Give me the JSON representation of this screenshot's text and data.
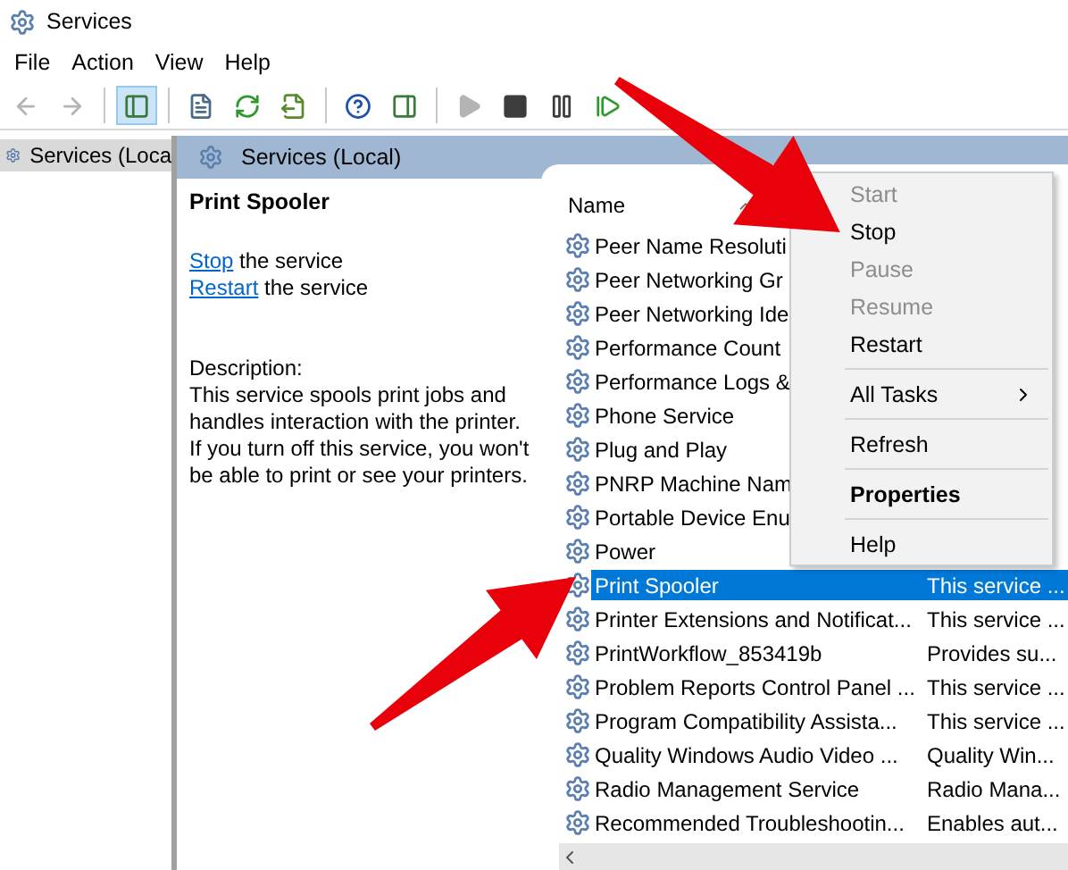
{
  "window": {
    "title": "Services"
  },
  "menu_bar": [
    "File",
    "Action",
    "View",
    "Help"
  ],
  "toolbar": [
    {
      "kind": "back",
      "disabled": true,
      "pressed": false
    },
    {
      "kind": "forward",
      "disabled": true,
      "pressed": false
    },
    {
      "kind": "separator"
    },
    {
      "kind": "console-tree",
      "disabled": false,
      "pressed": true
    },
    {
      "kind": "separator"
    },
    {
      "kind": "properties",
      "disabled": false,
      "pressed": false
    },
    {
      "kind": "refresh",
      "disabled": false,
      "pressed": false
    },
    {
      "kind": "export",
      "disabled": false,
      "pressed": false
    },
    {
      "kind": "separator"
    },
    {
      "kind": "help",
      "disabled": false,
      "pressed": false
    },
    {
      "kind": "action-pane",
      "disabled": false,
      "pressed": false
    },
    {
      "kind": "separator"
    },
    {
      "kind": "play",
      "disabled": true,
      "pressed": false
    },
    {
      "kind": "stop",
      "disabled": false,
      "pressed": false
    },
    {
      "kind": "pause",
      "disabled": false,
      "pressed": false
    },
    {
      "kind": "resume",
      "disabled": false,
      "pressed": false
    }
  ],
  "tree": {
    "items": [
      {
        "label": "Services (Loca",
        "selected": true
      }
    ]
  },
  "pane": {
    "title": "Services (Local)",
    "detail": {
      "title": "Print Spooler",
      "actions": [
        {
          "link": "Stop",
          "text": "the service"
        },
        {
          "link": "Restart",
          "text": "the service"
        }
      ],
      "description_label": "Description:",
      "description": "This service spools print jobs and handles interaction with the printer. If you turn off this service, you won't be able to print or see your printers."
    },
    "list": {
      "columns": [
        {
          "label": "Name",
          "sorted": true
        }
      ],
      "rows": [
        {
          "name": "Peer Name Resoluti",
          "selected": false
        },
        {
          "name": "Peer Networking Gr",
          "selected": false
        },
        {
          "name": "Peer Networking Ide",
          "selected": false
        },
        {
          "name": "Performance Count",
          "selected": false
        },
        {
          "name": "Performance Logs &",
          "selected": false
        },
        {
          "name": "Phone Service",
          "selected": false
        },
        {
          "name": "Plug and Play",
          "selected": false
        },
        {
          "name": "PNRP Machine Nam",
          "selected": false
        },
        {
          "name": "Portable Device Enu",
          "selected": false
        },
        {
          "name": "Power",
          "selected": false
        },
        {
          "name": "Print Spooler",
          "description": "This service ...",
          "selected": true
        },
        {
          "name": "Printer Extensions and Notificat...",
          "description": "This service ...",
          "selected": false
        },
        {
          "name": "PrintWorkflow_853419b",
          "description": "Provides su...",
          "selected": false
        },
        {
          "name": "Problem Reports Control Panel ...",
          "description": "This service ...",
          "selected": false
        },
        {
          "name": "Program Compatibility Assista...",
          "description": "This service ...",
          "selected": false
        },
        {
          "name": "Quality Windows Audio Video ...",
          "description": "Quality Win...",
          "selected": false
        },
        {
          "name": "Radio Management Service",
          "description": "Radio Mana...",
          "selected": false
        },
        {
          "name": "Recommended Troubleshootin...",
          "description": "Enables aut...",
          "selected": false
        }
      ]
    }
  },
  "context_menu": {
    "items": [
      {
        "kind": "item",
        "label": "Start",
        "disabled": true,
        "default": false,
        "submenu": false
      },
      {
        "kind": "item",
        "label": "Stop",
        "disabled": false,
        "default": false,
        "submenu": false
      },
      {
        "kind": "item",
        "label": "Pause",
        "disabled": true,
        "default": false,
        "submenu": false
      },
      {
        "kind": "item",
        "label": "Resume",
        "disabled": true,
        "default": false,
        "submenu": false
      },
      {
        "kind": "item",
        "label": "Restart",
        "disabled": false,
        "default": false,
        "submenu": false
      },
      {
        "kind": "separator"
      },
      {
        "kind": "item",
        "label": "All Tasks",
        "disabled": false,
        "default": false,
        "submenu": true
      },
      {
        "kind": "separator"
      },
      {
        "kind": "item",
        "label": "Refresh",
        "disabled": false,
        "default": false,
        "submenu": false
      },
      {
        "kind": "separator"
      },
      {
        "kind": "item",
        "label": "Properties",
        "disabled": false,
        "default": true,
        "submenu": false
      },
      {
        "kind": "separator"
      },
      {
        "kind": "item",
        "label": "Help",
        "disabled": false,
        "default": false,
        "submenu": false
      }
    ]
  }
}
